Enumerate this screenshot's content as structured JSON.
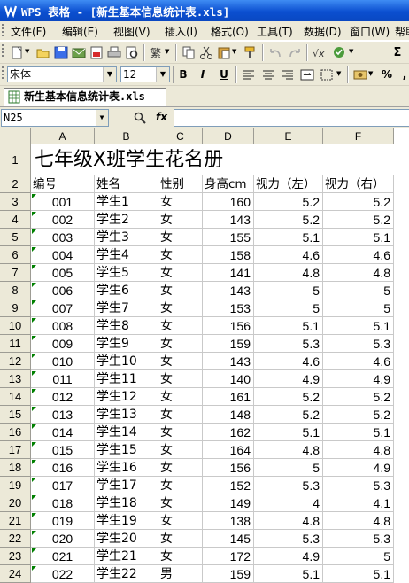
{
  "window": {
    "title": "WPS 表格 - [新生基本信息统计表.xls]"
  },
  "menu": [
    "文件(F)",
    "编辑(E)",
    "视图(V)",
    "插入(I)",
    "格式(O)",
    "工具(T)",
    "数据(D)",
    "窗口(W)",
    "帮助"
  ],
  "toolbar": {
    "font_name": "宋体",
    "font_size": "12",
    "bold": "B",
    "italic": "I",
    "underline": "U",
    "percent": "%",
    "sigma": "Σ"
  },
  "tab": {
    "label": "新生基本信息统计表.xls"
  },
  "formula": {
    "cell_ref": "N25",
    "fx": "fx"
  },
  "sheet": {
    "columns": [
      "A",
      "B",
      "C",
      "D",
      "E",
      "F"
    ],
    "title": "七年级X班学生花名册",
    "headers": [
      "编号",
      "姓名",
      "性别",
      "身高cm",
      "视力（左）",
      "视力（右）"
    ],
    "rows": [
      [
        "001",
        "学生1",
        "女",
        "160",
        "5.2",
        "5.2"
      ],
      [
        "002",
        "学生2",
        "女",
        "143",
        "5.2",
        "5.2"
      ],
      [
        "003",
        "学生3",
        "女",
        "155",
        "5.1",
        "5.1"
      ],
      [
        "004",
        "学生4",
        "女",
        "158",
        "4.6",
        "4.6"
      ],
      [
        "005",
        "学生5",
        "女",
        "141",
        "4.8",
        "4.8"
      ],
      [
        "006",
        "学生6",
        "女",
        "143",
        "5",
        "5"
      ],
      [
        "007",
        "学生7",
        "女",
        "153",
        "5",
        "5"
      ],
      [
        "008",
        "学生8",
        "女",
        "156",
        "5.1",
        "5.1"
      ],
      [
        "009",
        "学生9",
        "女",
        "159",
        "5.3",
        "5.3"
      ],
      [
        "010",
        "学生10",
        "女",
        "143",
        "4.6",
        "4.6"
      ],
      [
        "011",
        "学生11",
        "女",
        "140",
        "4.9",
        "4.9"
      ],
      [
        "012",
        "学生12",
        "女",
        "161",
        "5.2",
        "5.2"
      ],
      [
        "013",
        "学生13",
        "女",
        "148",
        "5.2",
        "5.2"
      ],
      [
        "014",
        "学生14",
        "女",
        "162",
        "5.1",
        "5.1"
      ],
      [
        "015",
        "学生15",
        "女",
        "164",
        "4.8",
        "4.8"
      ],
      [
        "016",
        "学生16",
        "女",
        "156",
        "5",
        "4.9"
      ],
      [
        "017",
        "学生17",
        "女",
        "152",
        "5.3",
        "5.3"
      ],
      [
        "018",
        "学生18",
        "女",
        "149",
        "4",
        "4.1"
      ],
      [
        "019",
        "学生19",
        "女",
        "138",
        "4.8",
        "4.8"
      ],
      [
        "020",
        "学生20",
        "女",
        "145",
        "5.3",
        "5.3"
      ],
      [
        "021",
        "学生21",
        "女",
        "172",
        "4.9",
        "5"
      ],
      [
        "022",
        "学生22",
        "男",
        "159",
        "5.1",
        "5.1"
      ]
    ]
  }
}
